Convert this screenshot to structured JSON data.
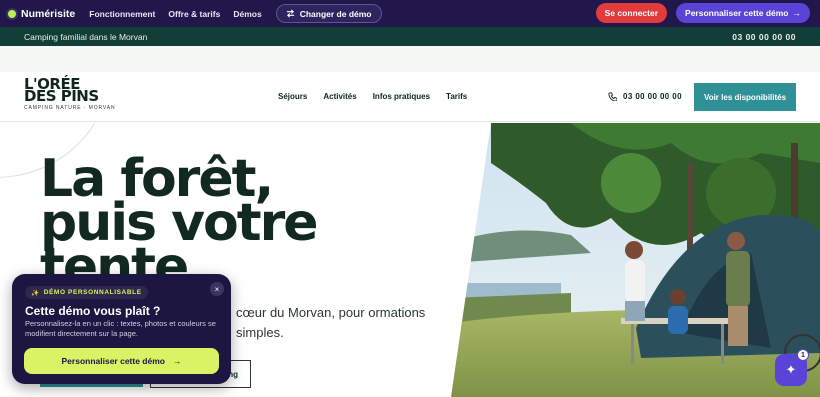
{
  "topbar": {
    "brand": "Numérisite",
    "nav": [
      "Fonctionnement",
      "Offre & tarifs",
      "Démos"
    ],
    "changer": "Changer de démo",
    "connect": "Se connecter",
    "personalize": "Personnaliser cette démo",
    "personalize_arrow": "→"
  },
  "infobar": {
    "tagline": "Camping familial dans le Morvan",
    "phone": "03 00 00 00 00"
  },
  "header": {
    "logo_line1": "L'ORÉE",
    "logo_line2": "DES PINS",
    "logo_sub": "CAMPING NATURE · MORVAN",
    "nav": [
      "Séjours",
      "Activités",
      "Infos pratiques",
      "Tarifs"
    ],
    "phone": "03 00 00 00 00",
    "cta": "Voir les disponibilités"
  },
  "hero": {
    "headline": "La forêt,\npuis votre\ntente.",
    "lede": "cœur du Morvan, pour\normations simples.",
    "secondary_cta_fragment": "ng"
  },
  "demo_card": {
    "badge": "DÉMO PERSONNALISABLE",
    "close": "×",
    "title": "Cette démo vous plaît ?",
    "text": "Personnalisez-la en un clic : textes, photos et couleurs se modifient directement sur la page.",
    "button": "Personnaliser cette démo",
    "button_arrow": "→"
  },
  "fab": {
    "count": "1",
    "icon": "sparkle-icon"
  },
  "colors": {
    "topbar": "#21174a",
    "infobar": "#123e38",
    "accent_teal": "#2f9097",
    "connect_red": "#e23b3b",
    "personalize_purple": "#5a44d8",
    "lime": "#d9f365"
  }
}
